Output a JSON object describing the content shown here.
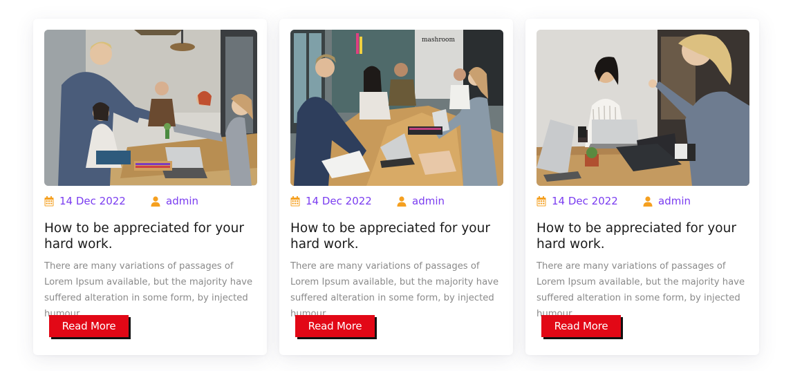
{
  "colors": {
    "accent": "#7a3cf0",
    "icon": "#f5a020",
    "button": "#e20816",
    "button_shadow": "#111111",
    "title": "#1a1a1a",
    "excerpt": "#8a8a8a"
  },
  "posts": [
    {
      "image": "team-handshake-meeting-photo",
      "date_icon": "calendar-icon",
      "date": "14 Dec 2022",
      "author_icon": "user-icon",
      "author": "admin",
      "title": "How to be appreciated for your hard work.",
      "excerpt": "There are many variations of passages of Lorem Ipsum available, but the majority have suffered alteration in some form, by injected humour.",
      "button_label": "Read More"
    },
    {
      "image": "team-conference-table-photo",
      "date_icon": "calendar-icon",
      "date": "14 Dec 2022",
      "author_icon": "user-icon",
      "author": "admin",
      "title": "How to be appreciated for your hard work.",
      "excerpt": "There are many variations of passages of Lorem Ipsum available, but the majority have suffered alteration in some form, by injected humour.",
      "button_label": "Read More"
    },
    {
      "image": "two-colleagues-discussion-photo",
      "date_icon": "calendar-icon",
      "date": "14 Dec 2022",
      "author_icon": "user-icon",
      "author": "admin",
      "title": "How to be appreciated for your hard work.",
      "excerpt": "There are many variations of passages of Lorem Ipsum available, but the majority have suffered alteration in some form, by injected humour.",
      "button_label": "Read More"
    }
  ]
}
